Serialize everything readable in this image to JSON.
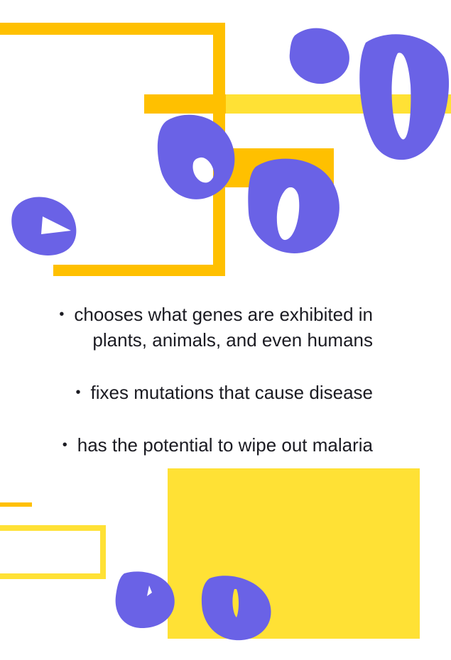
{
  "colors": {
    "orange_yellow": "#ffc000",
    "bright_yellow": "#ffe135",
    "purple": "#6a62e6",
    "text": "#1b1b22",
    "background": "#ffffff"
  },
  "bullets": [
    {
      "marker": "•",
      "text": "chooses what genes are exhibited in plants, animals, and even humans"
    },
    {
      "marker": "•",
      "text": "fixes mutations that cause disease"
    },
    {
      "marker": "•",
      "text": "has the potential to wipe out malaria"
    }
  ]
}
